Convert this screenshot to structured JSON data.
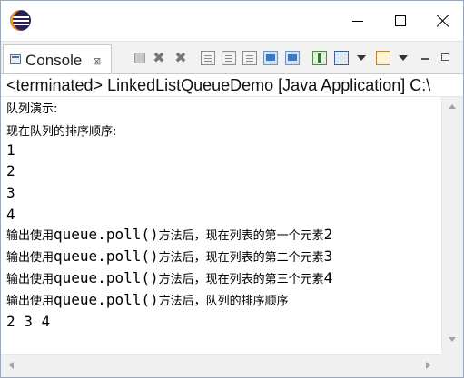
{
  "window": {
    "app_icon": "eclipse-icon",
    "controls": {
      "minimize_icon": "minimize-icon",
      "maximize_icon": "maximize-icon",
      "close_icon": "close-icon"
    }
  },
  "view": {
    "tab_label": "Console",
    "tab_icon": "console-icon",
    "tab_close_glyph": "⊠",
    "toolbar_icons": [
      "terminate-icon",
      "remove-launch-icon",
      "remove-all-terminated-icon",
      "clear-console-icon",
      "scroll-lock-icon",
      "word-wrap-icon",
      "show-on-stdout-icon",
      "show-on-stderr-icon",
      "pin-console-icon",
      "display-console-icon",
      "open-console-icon",
      "view-minimize-icon",
      "view-maximize-icon"
    ]
  },
  "status": {
    "text": "<terminated> LinkedListQueueDemo [Java Application] C:\\"
  },
  "console": {
    "lines": [
      {
        "text": "队列演示:"
      },
      {
        "text": "现在队列的排序顺序:"
      },
      {
        "text": "1"
      },
      {
        "text": "2"
      },
      {
        "text": "3"
      },
      {
        "text": "4"
      },
      {
        "prefix": "输出使用",
        "code": "queue.poll()",
        "suffix": "方法后，现在列表的第一个元素",
        "value": "2"
      },
      {
        "prefix": "输出使用",
        "code": "queue.poll()",
        "suffix": "方法后，现在列表的第二个元素",
        "value": "3"
      },
      {
        "prefix": "输出使用",
        "code": "queue.poll()",
        "suffix": "方法后，现在列表的第三个元素",
        "value": "4"
      },
      {
        "prefix": "输出使用",
        "code": "queue.poll()",
        "suffix": "方法后，队列的排序顺序",
        "value": ""
      },
      {
        "text": "2 3 4"
      }
    ]
  }
}
